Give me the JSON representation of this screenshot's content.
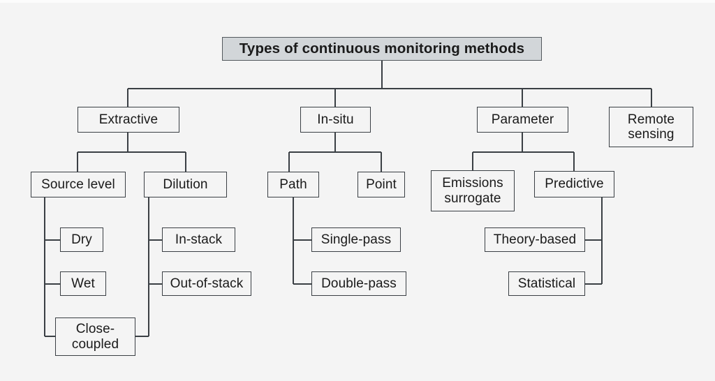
{
  "diagram": {
    "type": "tree",
    "title": "Types of continuous monitoring methods",
    "background_color": "#f4f4f4",
    "box_fill_color": "#f4f4f4",
    "title_fill_color": "#d2d6d9",
    "line_color": "#3a3f44",
    "text_color": "#1a1a1a",
    "nodes": {
      "root": "Types of continuous monitoring methods",
      "extractive": "Extractive",
      "insitu": "In-situ",
      "parameter": "Parameter",
      "remote_sensing": "Remote\nsensing",
      "source_level": "Source level",
      "dilution": "Dilution",
      "path": "Path",
      "point": "Point",
      "emissions_surrogate": "Emissions\nsurrogate",
      "predictive": "Predictive",
      "dry": "Dry",
      "wet": "Wet",
      "close_coupled": "Close-\ncoupled",
      "in_stack": "In-stack",
      "out_of_stack": "Out-of-stack",
      "single_pass": "Single-pass",
      "double_pass": "Double-pass",
      "theory_based": "Theory-based",
      "statistical": "Statistical"
    },
    "hierarchy": [
      {
        "label": "Types of continuous monitoring methods",
        "children": [
          {
            "label": "Extractive",
            "children": [
              {
                "label": "Source level",
                "children": [
                  {
                    "label": "Dry"
                  },
                  {
                    "label": "Wet"
                  },
                  {
                    "label": "Close-coupled"
                  }
                ]
              },
              {
                "label": "Dilution",
                "children": [
                  {
                    "label": "In-stack"
                  },
                  {
                    "label": "Out-of-stack"
                  },
                  {
                    "label": "Close-coupled"
                  }
                ]
              }
            ]
          },
          {
            "label": "In-situ",
            "children": [
              {
                "label": "Path",
                "children": [
                  {
                    "label": "Single-pass"
                  },
                  {
                    "label": "Double-pass"
                  }
                ]
              },
              {
                "label": "Point"
              }
            ]
          },
          {
            "label": "Parameter",
            "children": [
              {
                "label": "Emissions surrogate"
              },
              {
                "label": "Predictive",
                "children": [
                  {
                    "label": "Theory-based"
                  },
                  {
                    "label": "Statistical"
                  }
                ]
              }
            ]
          },
          {
            "label": "Remote sensing"
          }
        ]
      }
    ]
  }
}
